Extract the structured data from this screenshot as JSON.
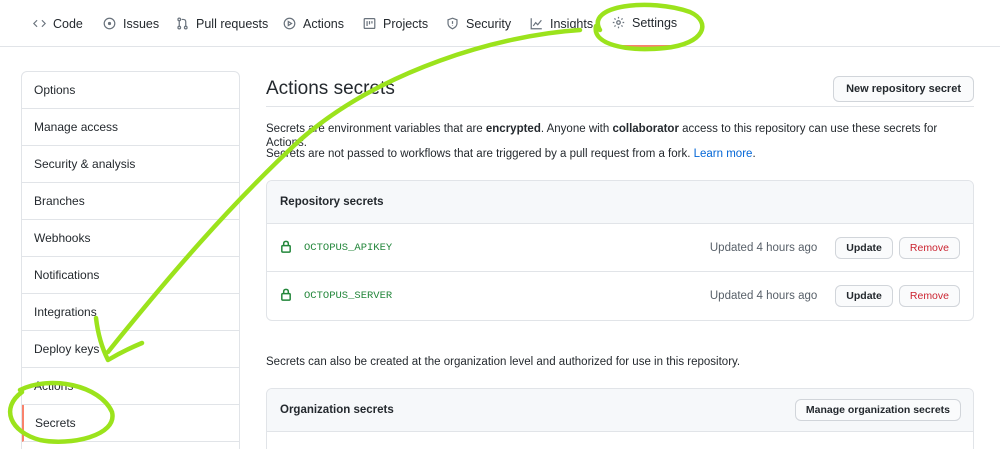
{
  "nav": {
    "tabs": [
      {
        "label": "Code",
        "icon": "code-icon"
      },
      {
        "label": "Issues",
        "icon": "issue-icon"
      },
      {
        "label": "Pull requests",
        "icon": "pull-request-icon"
      },
      {
        "label": "Actions",
        "icon": "play-icon"
      },
      {
        "label": "Projects",
        "icon": "project-icon"
      },
      {
        "label": "Security",
        "icon": "shield-icon"
      },
      {
        "label": "Insights",
        "icon": "graph-icon"
      },
      {
        "label": "Settings",
        "icon": "gear-icon"
      }
    ],
    "selected": "Settings"
  },
  "sidebar": {
    "items": [
      {
        "label": "Options"
      },
      {
        "label": "Manage access"
      },
      {
        "label": "Security & analysis"
      },
      {
        "label": "Branches"
      },
      {
        "label": "Webhooks"
      },
      {
        "label": "Notifications"
      },
      {
        "label": "Integrations"
      },
      {
        "label": "Deploy keys"
      },
      {
        "label": "Actions"
      },
      {
        "label": "Secrets"
      }
    ],
    "selected": "Secrets"
  },
  "main": {
    "title": "Actions secrets",
    "new_secret_label": "New repository secret",
    "desc1": {
      "p1": "Secrets are environment variables that are ",
      "b1": "encrypted",
      "p2": ". Anyone with ",
      "b2": "collaborator",
      "p3": " access to this repository can use these secrets for Actions."
    },
    "desc2": {
      "text": "Secrets are not passed to workflows that are triggered by a pull request from a fork. ",
      "link": "Learn more",
      "end": "."
    },
    "repo_secrets": {
      "header": "Repository secrets",
      "rows": [
        {
          "name": "OCTOPUS_APIKEY",
          "updated": "Updated 4 hours ago",
          "update_label": "Update",
          "remove_label": "Remove"
        },
        {
          "name": "OCTOPUS_SERVER",
          "updated": "Updated 4 hours ago",
          "update_label": "Update",
          "remove_label": "Remove"
        }
      ]
    },
    "org_note": "Secrets can also be created at the organization level and authorized for use in this repository.",
    "org_secrets": {
      "header": "Organization secrets",
      "manage_label": "Manage organization secrets"
    }
  },
  "colors": {
    "accent_tab": "#f9826c",
    "secret_green": "#22863a",
    "danger": "#cb2431",
    "link": "#0366d6",
    "annotation": "#9be31c"
  }
}
